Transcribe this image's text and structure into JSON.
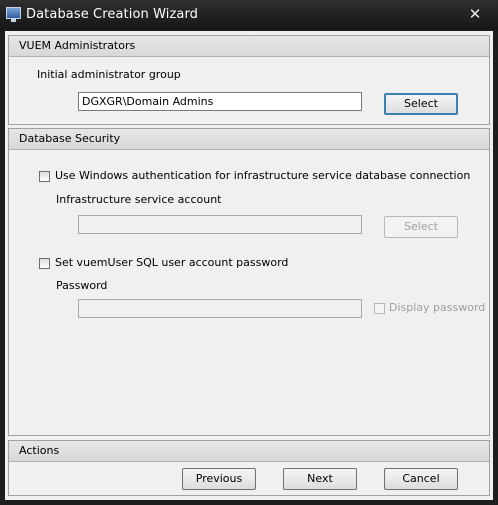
{
  "window": {
    "title": "Database Creation Wizard",
    "close_glyph": "✕"
  },
  "vuem_admins": {
    "header": "VUEM Administrators",
    "group_label": "Initial administrator group",
    "group_value": "DGXGR\\Domain Admins",
    "select_label": "Select"
  },
  "db_security": {
    "header": "Database Security",
    "windows_auth_label": "Use Windows authentication for infrastructure service database connection",
    "windows_auth_checked": false,
    "service_account_label": "Infrastructure service account",
    "service_account_value": "",
    "service_select_label": "Select",
    "sql_password_label": "Set vuemUser SQL user account password",
    "sql_password_checked": false,
    "password_label": "Password",
    "password_value": "",
    "display_password_label": "Display password"
  },
  "actions": {
    "header": "Actions",
    "previous_label": "Previous",
    "next_label": "Next",
    "cancel_label": "Cancel"
  },
  "icons": {
    "app": "monitor-icon",
    "close": "close-icon"
  }
}
